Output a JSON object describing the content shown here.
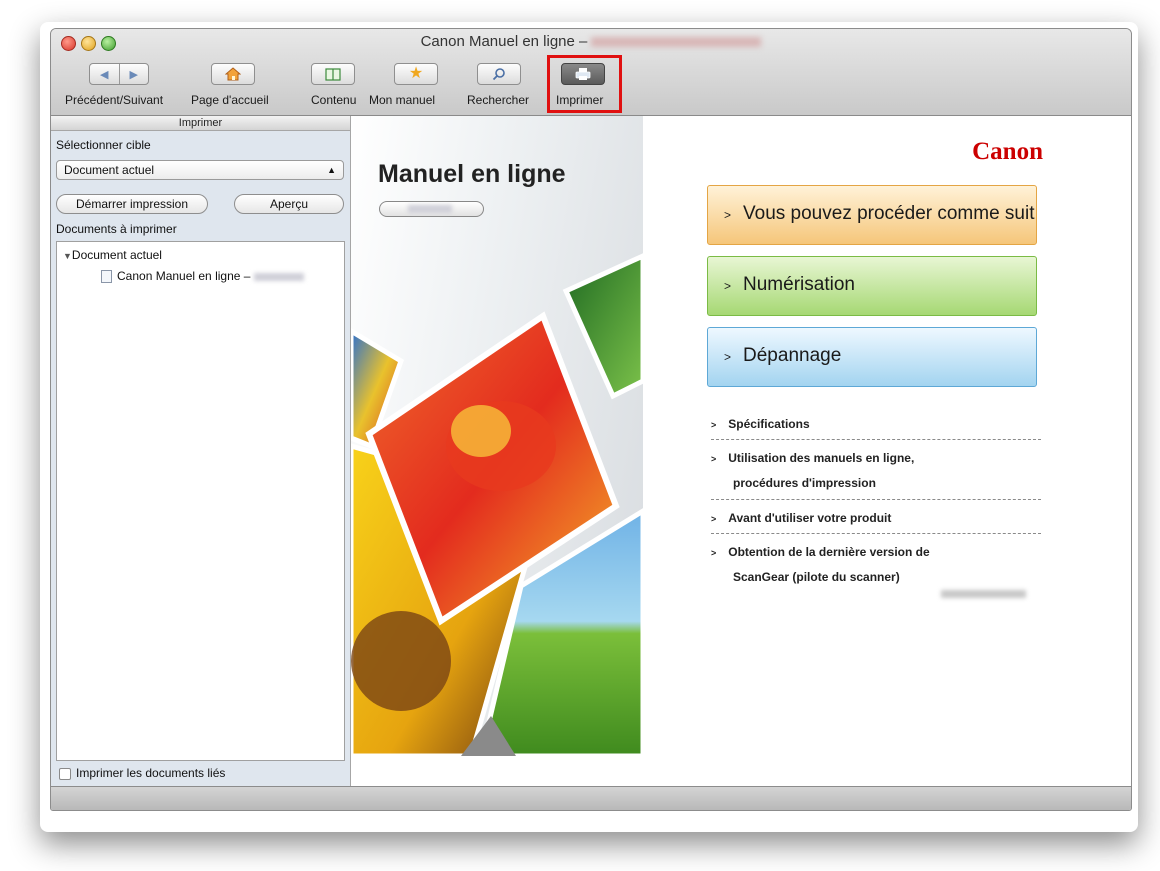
{
  "window": {
    "title": "Canon Manuel en ligne –"
  },
  "toolbar": {
    "back_forward_label": "Précédent/Suivant",
    "home_label": "Page d'accueil",
    "contents_label": "Contenu",
    "my_manual_label": "Mon manuel",
    "search_label": "Rechercher",
    "print_label": "Imprimer"
  },
  "sidebar": {
    "header": "Imprimer",
    "select_target_label": "Sélectionner cible",
    "select_value": "Document actuel",
    "start_print_label": "Démarrer impression",
    "preview_label": "Aperçu",
    "docs_to_print_label": "Documents à imprimer",
    "tree": {
      "root": "Document actuel",
      "child": "Canon Manuel en ligne –"
    },
    "print_linked_label": "Imprimer les documents liés"
  },
  "content": {
    "manual_title": "Manuel en ligne",
    "brand": "Canon",
    "buttons": [
      {
        "label": "Vous pouvez procéder comme suit"
      },
      {
        "label": "Numérisation"
      },
      {
        "label": "Dépannage"
      }
    ],
    "links": [
      {
        "label": "Spécifications"
      },
      {
        "label": "Utilisation des manuels en ligne,"
      },
      {
        "label": "procédures d'impression"
      },
      {
        "label": "Avant d'utiliser votre produit"
      },
      {
        "label": "Obtention de la dernière version de"
      },
      {
        "label": "ScanGear (pilote du scanner)"
      }
    ]
  },
  "colors": {
    "canon_red": "#cc0000",
    "highlight_red": "#e01010",
    "orange_button": "#f5c67a",
    "green_button": "#a6d873",
    "blue_button": "#a3d4f0"
  },
  "icons": [
    "back-icon",
    "forward-icon",
    "home-icon",
    "book-icon",
    "star-icon",
    "search-icon",
    "printer-icon",
    "document-icon",
    "disclosure-triangle-icon"
  ]
}
